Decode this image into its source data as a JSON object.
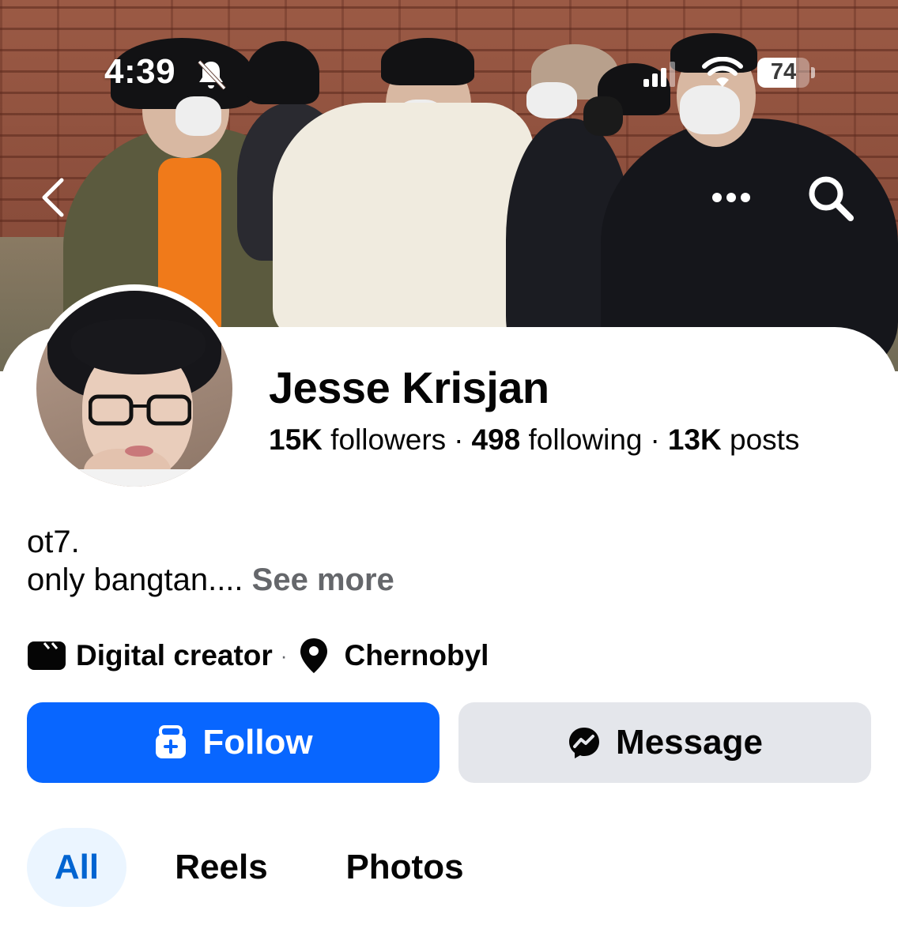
{
  "status_bar": {
    "time": "4:39",
    "battery_percent": "74",
    "battery_level": 0.74,
    "icons": [
      "bell-slash-icon",
      "signal-icon",
      "wifi-icon",
      "battery-icon"
    ]
  },
  "header": {
    "back_icon": "chevron-left-icon",
    "more_icon": "ellipsis-icon",
    "search_icon": "search-icon"
  },
  "profile": {
    "name": "Jesse Krisjan",
    "followers_count": "15K",
    "followers_label": "followers",
    "following_count": "498",
    "following_label": "following",
    "posts_count": "13K",
    "posts_label": "posts",
    "separator": "·"
  },
  "bio": {
    "line1": "ot7.",
    "line2": "only bangtan....",
    "see_more": "See more"
  },
  "details": {
    "category": "Digital creator",
    "category_icon": "clapperboard-icon",
    "separator": "·",
    "location": "Chernobyl",
    "location_icon": "map-pin-icon"
  },
  "actions": {
    "follow_label": "Follow",
    "follow_icon": "follow-plus-icon",
    "message_label": "Message",
    "message_icon": "messenger-icon"
  },
  "tabs": [
    {
      "label": "All",
      "active": true
    },
    {
      "label": "Reels",
      "active": false
    },
    {
      "label": "Photos",
      "active": false
    }
  ],
  "colors": {
    "primary_blue": "#0866ff",
    "active_tab_bg": "#ebf5ff",
    "active_tab_text": "#0064d1",
    "secondary_button": "#e4e6eb",
    "muted_text": "#65676b"
  }
}
